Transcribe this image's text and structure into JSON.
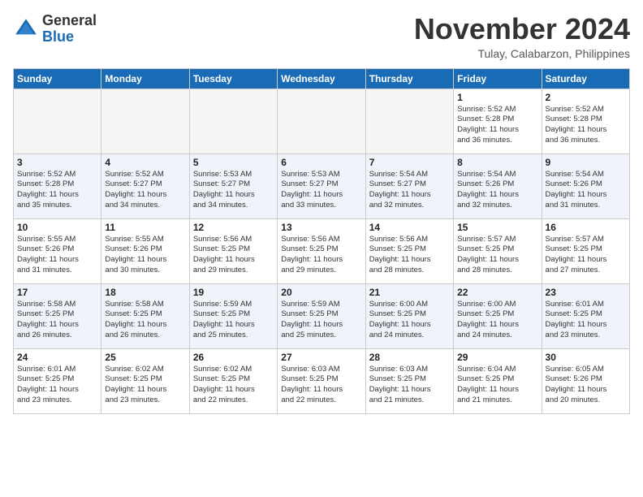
{
  "header": {
    "logo_general": "General",
    "logo_blue": "Blue",
    "month": "November 2024",
    "location": "Tulay, Calabarzon, Philippines"
  },
  "days_of_week": [
    "Sunday",
    "Monday",
    "Tuesday",
    "Wednesday",
    "Thursday",
    "Friday",
    "Saturday"
  ],
  "weeks": [
    [
      {
        "day": "",
        "text": ""
      },
      {
        "day": "",
        "text": ""
      },
      {
        "day": "",
        "text": ""
      },
      {
        "day": "",
        "text": ""
      },
      {
        "day": "",
        "text": ""
      },
      {
        "day": "1",
        "text": "Sunrise: 5:52 AM\nSunset: 5:28 PM\nDaylight: 11 hours\nand 36 minutes."
      },
      {
        "day": "2",
        "text": "Sunrise: 5:52 AM\nSunset: 5:28 PM\nDaylight: 11 hours\nand 36 minutes."
      }
    ],
    [
      {
        "day": "3",
        "text": "Sunrise: 5:52 AM\nSunset: 5:28 PM\nDaylight: 11 hours\nand 35 minutes."
      },
      {
        "day": "4",
        "text": "Sunrise: 5:52 AM\nSunset: 5:27 PM\nDaylight: 11 hours\nand 34 minutes."
      },
      {
        "day": "5",
        "text": "Sunrise: 5:53 AM\nSunset: 5:27 PM\nDaylight: 11 hours\nand 34 minutes."
      },
      {
        "day": "6",
        "text": "Sunrise: 5:53 AM\nSunset: 5:27 PM\nDaylight: 11 hours\nand 33 minutes."
      },
      {
        "day": "7",
        "text": "Sunrise: 5:54 AM\nSunset: 5:27 PM\nDaylight: 11 hours\nand 32 minutes."
      },
      {
        "day": "8",
        "text": "Sunrise: 5:54 AM\nSunset: 5:26 PM\nDaylight: 11 hours\nand 32 minutes."
      },
      {
        "day": "9",
        "text": "Sunrise: 5:54 AM\nSunset: 5:26 PM\nDaylight: 11 hours\nand 31 minutes."
      }
    ],
    [
      {
        "day": "10",
        "text": "Sunrise: 5:55 AM\nSunset: 5:26 PM\nDaylight: 11 hours\nand 31 minutes."
      },
      {
        "day": "11",
        "text": "Sunrise: 5:55 AM\nSunset: 5:26 PM\nDaylight: 11 hours\nand 30 minutes."
      },
      {
        "day": "12",
        "text": "Sunrise: 5:56 AM\nSunset: 5:25 PM\nDaylight: 11 hours\nand 29 minutes."
      },
      {
        "day": "13",
        "text": "Sunrise: 5:56 AM\nSunset: 5:25 PM\nDaylight: 11 hours\nand 29 minutes."
      },
      {
        "day": "14",
        "text": "Sunrise: 5:56 AM\nSunset: 5:25 PM\nDaylight: 11 hours\nand 28 minutes."
      },
      {
        "day": "15",
        "text": "Sunrise: 5:57 AM\nSunset: 5:25 PM\nDaylight: 11 hours\nand 28 minutes."
      },
      {
        "day": "16",
        "text": "Sunrise: 5:57 AM\nSunset: 5:25 PM\nDaylight: 11 hours\nand 27 minutes."
      }
    ],
    [
      {
        "day": "17",
        "text": "Sunrise: 5:58 AM\nSunset: 5:25 PM\nDaylight: 11 hours\nand 26 minutes."
      },
      {
        "day": "18",
        "text": "Sunrise: 5:58 AM\nSunset: 5:25 PM\nDaylight: 11 hours\nand 26 minutes."
      },
      {
        "day": "19",
        "text": "Sunrise: 5:59 AM\nSunset: 5:25 PM\nDaylight: 11 hours\nand 25 minutes."
      },
      {
        "day": "20",
        "text": "Sunrise: 5:59 AM\nSunset: 5:25 PM\nDaylight: 11 hours\nand 25 minutes."
      },
      {
        "day": "21",
        "text": "Sunrise: 6:00 AM\nSunset: 5:25 PM\nDaylight: 11 hours\nand 24 minutes."
      },
      {
        "day": "22",
        "text": "Sunrise: 6:00 AM\nSunset: 5:25 PM\nDaylight: 11 hours\nand 24 minutes."
      },
      {
        "day": "23",
        "text": "Sunrise: 6:01 AM\nSunset: 5:25 PM\nDaylight: 11 hours\nand 23 minutes."
      }
    ],
    [
      {
        "day": "24",
        "text": "Sunrise: 6:01 AM\nSunset: 5:25 PM\nDaylight: 11 hours\nand 23 minutes."
      },
      {
        "day": "25",
        "text": "Sunrise: 6:02 AM\nSunset: 5:25 PM\nDaylight: 11 hours\nand 23 minutes."
      },
      {
        "day": "26",
        "text": "Sunrise: 6:02 AM\nSunset: 5:25 PM\nDaylight: 11 hours\nand 22 minutes."
      },
      {
        "day": "27",
        "text": "Sunrise: 6:03 AM\nSunset: 5:25 PM\nDaylight: 11 hours\nand 22 minutes."
      },
      {
        "day": "28",
        "text": "Sunrise: 6:03 AM\nSunset: 5:25 PM\nDaylight: 11 hours\nand 21 minutes."
      },
      {
        "day": "29",
        "text": "Sunrise: 6:04 AM\nSunset: 5:25 PM\nDaylight: 11 hours\nand 21 minutes."
      },
      {
        "day": "30",
        "text": "Sunrise: 6:05 AM\nSunset: 5:26 PM\nDaylight: 11 hours\nand 20 minutes."
      }
    ]
  ]
}
